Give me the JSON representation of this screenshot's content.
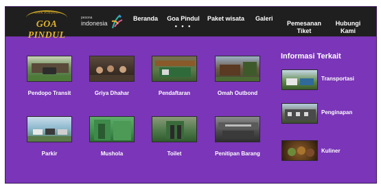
{
  "brand": {
    "logo_text": "GOA PINDUL",
    "logo_subtext": "GOA PINDUL",
    "pesona_small": "pesona",
    "pesona_big": "indonesia"
  },
  "nav": {
    "items": [
      {
        "label": "Beranda"
      },
      {
        "label": "Goa Pindul",
        "active_marker": "• • •"
      },
      {
        "label": "Paket wisata"
      },
      {
        "label": "Galeri"
      },
      {
        "label": "Pemesanan\nTiket"
      },
      {
        "label": "Hubungi\nKami"
      }
    ]
  },
  "facilities": [
    {
      "label": "Pendopo Transit"
    },
    {
      "label": "Griya Dhahar"
    },
    {
      "label": "Pendaftaran"
    },
    {
      "label": "Omah Outbond"
    },
    {
      "label": "Parkir"
    },
    {
      "label": "Mushola"
    },
    {
      "label": "Toilet"
    },
    {
      "label": "Penitipan Barang"
    }
  ],
  "related": {
    "title": "Informasi Terkait",
    "items": [
      {
        "label": "Transportasi"
      },
      {
        "label": "Penginapan"
      },
      {
        "label": "Kuliner"
      }
    ]
  },
  "colors": {
    "background": "#7a35b8",
    "navbar": "#1f1f1f",
    "logo_gold": "#e0b330"
  }
}
